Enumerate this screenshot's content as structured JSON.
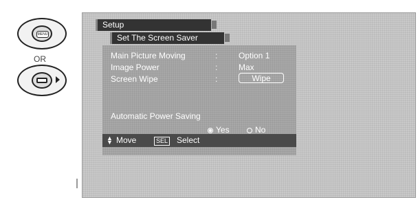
{
  "remote": {
    "menu_key_label": "MENU",
    "or_label": "OR"
  },
  "osd": {
    "setup_tab": "Setup",
    "submenu_tab": "Set The Screen Saver",
    "rows": [
      {
        "label": "Main Picture Moving",
        "value": "Option 1"
      },
      {
        "label": "Image Power",
        "value": "Max"
      },
      {
        "label": "Screen Wipe",
        "value": "Wipe"
      }
    ],
    "automatic_power_saving": {
      "title": "Automatic Power Saving",
      "options": [
        {
          "label": "Yes",
          "selected": true
        },
        {
          "label": "No",
          "selected": false
        }
      ]
    },
    "footer": {
      "move_label": "Move",
      "sel_key": "SEL",
      "select_label": "Select"
    }
  }
}
